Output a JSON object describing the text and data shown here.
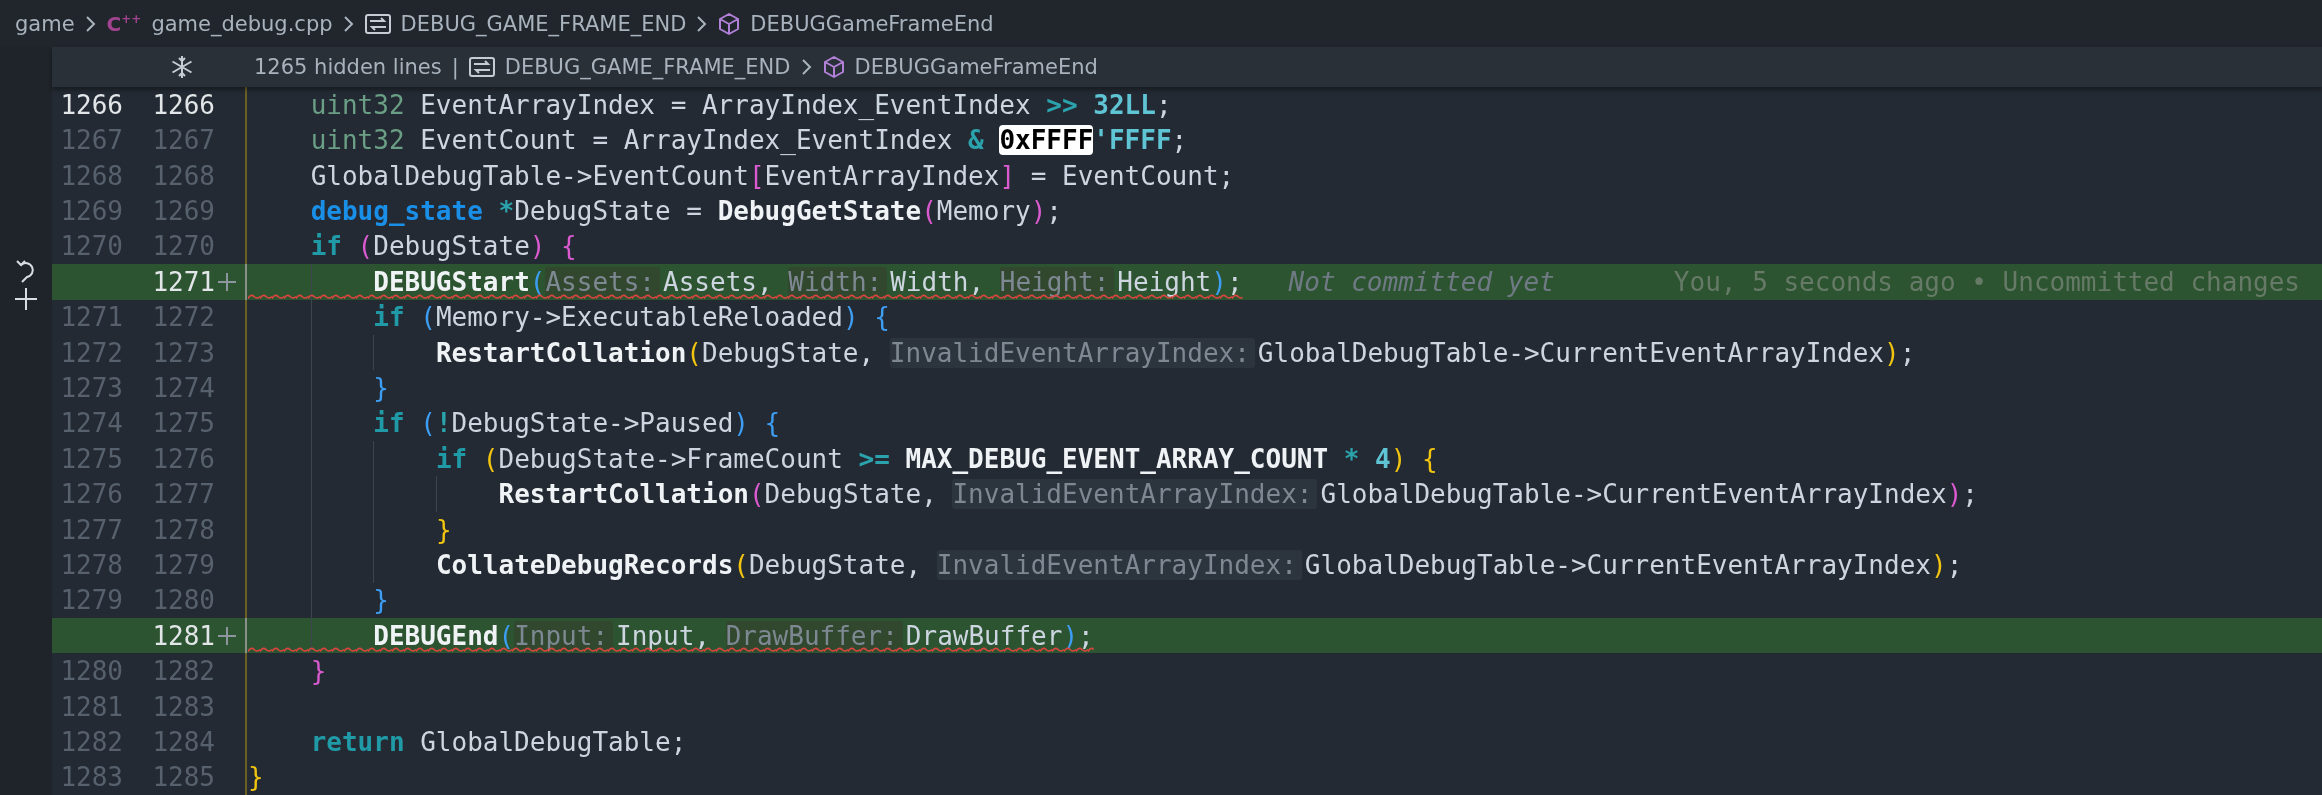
{
  "breadcrumb": [
    {
      "kind": "folder",
      "label": "game"
    },
    {
      "kind": "file",
      "icon_text": "C$^{++}$",
      "label": "game_debug.cpp"
    },
    {
      "kind": "macro",
      "label": "DEBUG_GAME_FRAME_END"
    },
    {
      "kind": "function",
      "label": "DEBUGGameFrameEnd"
    }
  ],
  "sticky_scroll": {
    "hidden_lines": "1265 hidden lines",
    "separator": "|",
    "path": [
      {
        "kind": "macro",
        "label": "DEBUG_GAME_FRAME_END"
      },
      {
        "kind": "function",
        "label": "DEBUGGameFrameEnd"
      }
    ]
  },
  "lines": [
    {
      "old": "1266",
      "new": "1266",
      "current": true,
      "added": false,
      "tokens": [
        {
          "kind": "type",
          "text": "    uint32"
        },
        {
          "kind": "plain",
          "text": " EventArrayIndex = ArrayIndex_EventIndex "
        },
        {
          "kind": "op",
          "text": ">> "
        },
        {
          "kind": "number",
          "text": "32LL"
        },
        {
          "kind": "plain",
          "text": ";"
        }
      ]
    },
    {
      "old": "1267",
      "new": "1267",
      "current": false,
      "added": false,
      "tokens": [
        {
          "kind": "type",
          "text": "    uint32"
        },
        {
          "kind": "plain",
          "text": " EventCount = ArrayIndex_EventIndex "
        },
        {
          "kind": "op",
          "text": "& "
        },
        {
          "kind": "match",
          "text": "0xFFFF"
        },
        {
          "kind": "number",
          "text": "'FFFF"
        },
        {
          "kind": "plain",
          "text": ";"
        }
      ]
    },
    {
      "old": "1268",
      "new": "1268",
      "current": false,
      "added": false,
      "tokens": [
        {
          "kind": "plain",
          "text": "    GlobalDebugTable->EventCount"
        },
        {
          "kind": "bracket",
          "text": "[",
          "color": "#da5ad0"
        },
        {
          "kind": "plain",
          "text": "EventArrayIndex"
        },
        {
          "kind": "bracket",
          "text": "]",
          "color": "#da5ad0"
        },
        {
          "kind": "plain",
          "text": " = EventCount;"
        }
      ]
    },
    {
      "old": "1269",
      "new": "1269",
      "current": false,
      "added": false,
      "tokens": [
        {
          "kind": "storage",
          "text": "    debug_state "
        },
        {
          "kind": "op",
          "text": "*"
        },
        {
          "kind": "plain",
          "text": "DebugState = "
        },
        {
          "kind": "func",
          "text": "DebugGetState"
        },
        {
          "kind": "bracket",
          "text": "(",
          "color": "#da5ad0"
        },
        {
          "kind": "plain",
          "text": "Memory"
        },
        {
          "kind": "bracket",
          "text": ")",
          "color": "#da5ad0"
        },
        {
          "kind": "plain",
          "text": ";"
        }
      ]
    },
    {
      "old": "1270",
      "new": "1270",
      "current": false,
      "added": false,
      "tokens": [
        {
          "kind": "keyword",
          "text": "    if "
        },
        {
          "kind": "bracket",
          "text": "(",
          "color": "#da5ad0"
        },
        {
          "kind": "plain",
          "text": "DebugState"
        },
        {
          "kind": "bracket",
          "text": ") ",
          "color": "#da5ad0"
        },
        {
          "kind": "bracket",
          "text": "{",
          "color": "#da5ad0"
        }
      ]
    },
    {
      "new": "1271",
      "current": false,
      "added": true,
      "blame": {
        "note": "Not committed yet",
        "detail": "You, 5 seconds ago • Uncommitted changes"
      },
      "tokens": [
        {
          "kind": "func",
          "text": "        DEBUGStart"
        },
        {
          "kind": "bracket",
          "text": "(",
          "color": "#3d9df2"
        },
        {
          "kind": "hint",
          "text": "Assets:"
        },
        {
          "kind": "plain",
          "text": "Assets, "
        },
        {
          "kind": "hint",
          "text": "Width:"
        },
        {
          "kind": "plain",
          "text": "Width, "
        },
        {
          "kind": "hint",
          "text": "Height:"
        },
        {
          "kind": "plain",
          "text": "Height"
        },
        {
          "kind": "bracket",
          "text": ")",
          "color": "#3d9df2"
        },
        {
          "kind": "plain",
          "text": ";"
        }
      ]
    },
    {
      "old": "1271",
      "new": "1272",
      "current": false,
      "added": false,
      "tokens": [
        {
          "kind": "keyword",
          "text": "        if "
        },
        {
          "kind": "bracket",
          "text": "(",
          "color": "#3d9df2"
        },
        {
          "kind": "plain",
          "text": "Memory->ExecutableReloaded"
        },
        {
          "kind": "bracket",
          "text": ") ",
          "color": "#3d9df2"
        },
        {
          "kind": "bracket",
          "text": "{",
          "color": "#3d9df2"
        }
      ]
    },
    {
      "old": "1272",
      "new": "1273",
      "current": false,
      "added": false,
      "tokens": [
        {
          "kind": "func",
          "text": "            RestartCollation"
        },
        {
          "kind": "bracket",
          "text": "(",
          "color": "#f1c40f"
        },
        {
          "kind": "plain",
          "text": "DebugState, "
        },
        {
          "kind": "hint",
          "text": "InvalidEventArrayIndex:"
        },
        {
          "kind": "plain",
          "text": "GlobalDebugTable->CurrentEventArrayIndex"
        },
        {
          "kind": "bracket",
          "text": ")",
          "color": "#f1c40f"
        },
        {
          "kind": "plain",
          "text": ";"
        }
      ]
    },
    {
      "old": "1273",
      "new": "1274",
      "current": false,
      "added": false,
      "tokens": [
        {
          "kind": "bracket",
          "text": "        }",
          "color": "#3d9df2"
        }
      ]
    },
    {
      "old": "1274",
      "new": "1275",
      "current": false,
      "added": false,
      "tokens": [
        {
          "kind": "keyword",
          "text": "        if "
        },
        {
          "kind": "bracket",
          "text": "(",
          "color": "#3d9df2"
        },
        {
          "kind": "op",
          "text": "!"
        },
        {
          "kind": "plain",
          "text": "DebugState->Paused"
        },
        {
          "kind": "bracket",
          "text": ") ",
          "color": "#3d9df2"
        },
        {
          "kind": "bracket",
          "text": "{",
          "color": "#3d9df2"
        }
      ]
    },
    {
      "old": "1275",
      "new": "1276",
      "current": false,
      "added": false,
      "tokens": [
        {
          "kind": "keyword",
          "text": "            if "
        },
        {
          "kind": "bracket",
          "text": "(",
          "color": "#f1c40f"
        },
        {
          "kind": "plain",
          "text": "DebugState->FrameCount "
        },
        {
          "kind": "op",
          "text": ">= "
        },
        {
          "kind": "macro",
          "text": "MAX_DEBUG_EVENT_ARRAY_COUNT "
        },
        {
          "kind": "op",
          "text": "* "
        },
        {
          "kind": "number",
          "text": "4"
        },
        {
          "kind": "bracket",
          "text": ") ",
          "color": "#f1c40f"
        },
        {
          "kind": "bracket",
          "text": "{",
          "color": "#f1c40f"
        }
      ]
    },
    {
      "old": "1276",
      "new": "1277",
      "current": false,
      "added": false,
      "tokens": [
        {
          "kind": "func",
          "text": "                RestartCollation"
        },
        {
          "kind": "bracket",
          "text": "(",
          "color": "#da5ad0"
        },
        {
          "kind": "plain",
          "text": "DebugState, "
        },
        {
          "kind": "hint",
          "text": "InvalidEventArrayIndex:"
        },
        {
          "kind": "plain",
          "text": "GlobalDebugTable->CurrentEventArrayIndex"
        },
        {
          "kind": "bracket",
          "text": ")",
          "color": "#da5ad0"
        },
        {
          "kind": "plain",
          "text": ";"
        }
      ]
    },
    {
      "old": "1277",
      "new": "1278",
      "current": false,
      "added": false,
      "tokens": [
        {
          "kind": "bracket",
          "text": "            }",
          "color": "#f1c40f"
        }
      ]
    },
    {
      "old": "1278",
      "new": "1279",
      "current": false,
      "added": false,
      "tokens": [
        {
          "kind": "func",
          "text": "            CollateDebugRecords"
        },
        {
          "kind": "bracket",
          "text": "(",
          "color": "#f1c40f"
        },
        {
          "kind": "plain",
          "text": "DebugState, "
        },
        {
          "kind": "hint",
          "text": "InvalidEventArrayIndex:"
        },
        {
          "kind": "plain",
          "text": "GlobalDebugTable->CurrentEventArrayIndex"
        },
        {
          "kind": "bracket",
          "text": ")",
          "color": "#f1c40f"
        },
        {
          "kind": "plain",
          "text": ";"
        }
      ]
    },
    {
      "old": "1279",
      "new": "1280",
      "current": false,
      "added": false,
      "tokens": [
        {
          "kind": "bracket",
          "text": "        }",
          "color": "#3d9df2"
        }
      ]
    },
    {
      "new": "1281",
      "current": false,
      "added": true,
      "tokens": [
        {
          "kind": "func",
          "text": "        DEBUGEnd"
        },
        {
          "kind": "bracket",
          "text": "(",
          "color": "#3d9df2"
        },
        {
          "kind": "hint",
          "text": "Input:"
        },
        {
          "kind": "plain",
          "text": "Input, "
        },
        {
          "kind": "hint",
          "text": "DrawBuffer:"
        },
        {
          "kind": "plain",
          "text": "DrawBuffer"
        },
        {
          "kind": "bracket",
          "text": ")",
          "color": "#3d9df2"
        },
        {
          "kind": "plain",
          "text": ";"
        }
      ]
    },
    {
      "old": "1280",
      "new": "1282",
      "current": false,
      "added": false,
      "tokens": [
        {
          "kind": "bracket",
          "text": "    }",
          "color": "#da5ad0"
        }
      ]
    },
    {
      "old": "1281",
      "new": "1283",
      "current": false,
      "added": false
    },
    {
      "old": "1282",
      "new": "1284",
      "current": false,
      "added": false,
      "tokens": [
        {
          "kind": "keyword",
          "text": "    return "
        },
        {
          "kind": "plain",
          "text": "GlobalDebugTable;"
        }
      ]
    },
    {
      "old": "1283",
      "new": "1285",
      "current": false,
      "added": false,
      "tokens": [
        {
          "kind": "bracket",
          "text": "}",
          "color": "#f1c40f"
        }
      ]
    }
  ]
}
